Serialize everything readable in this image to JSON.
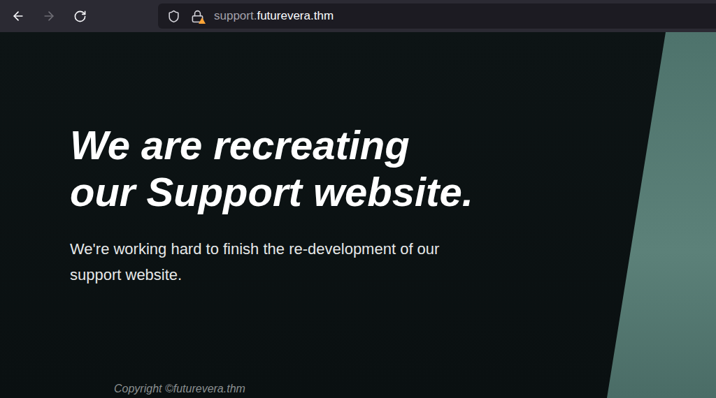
{
  "browser": {
    "back_enabled": true,
    "forward_enabled": false,
    "url": {
      "subdomain": "support.",
      "domain": "futurevera.thm"
    },
    "connection_warning": true
  },
  "page": {
    "heading": "We are recreating our Support website.",
    "subtitle": "We're working hard to finish the re-development of our support website.",
    "copyright": "Copyright ©futurevera.thm"
  }
}
